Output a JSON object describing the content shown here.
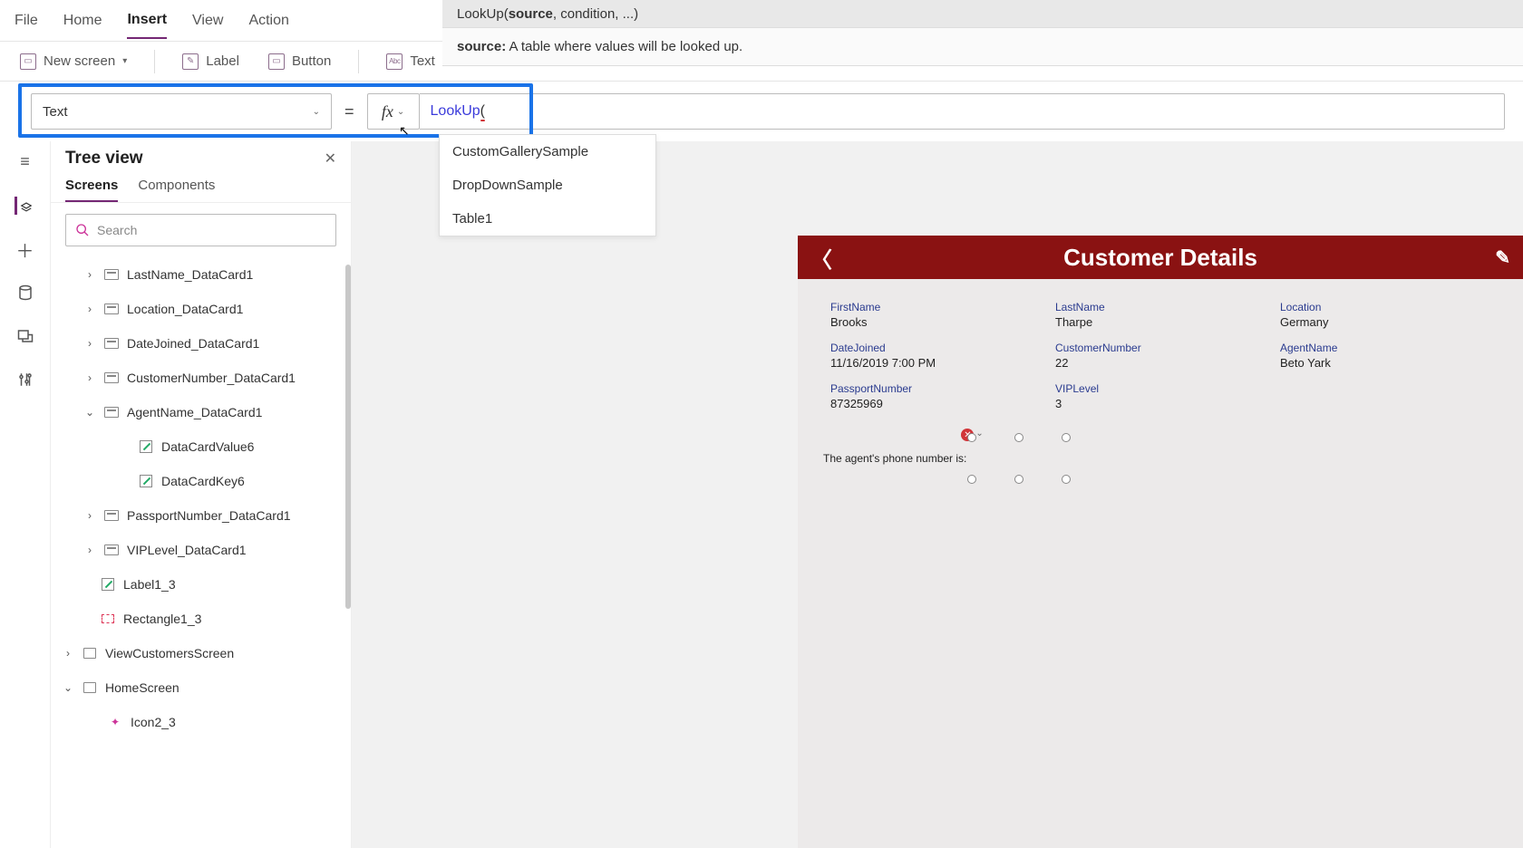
{
  "menubar": {
    "file": "File",
    "home": "Home",
    "insert": "Insert",
    "view": "View",
    "action": "Action"
  },
  "ribbon": {
    "new_screen": "New screen",
    "label": "Label",
    "button": "Button",
    "text": "Text"
  },
  "formula": {
    "property": "Text",
    "eq": "=",
    "fx": "fx",
    "fn_name": "LookUp",
    "fn_paren": "("
  },
  "hint": {
    "signature_pre": "LookUp(",
    "signature_bold": "source",
    "signature_post": ", condition, ...)",
    "desc_bold": "source:",
    "desc_text": " A table where values will be looked up."
  },
  "suggestions": [
    "CustomGallerySample",
    "DropDownSample",
    "Table1"
  ],
  "tree": {
    "title": "Tree view",
    "tabs": {
      "screens": "Screens",
      "components": "Components"
    },
    "search_placeholder": "Search",
    "items": [
      {
        "label": "LastName_DataCard1",
        "icon": "card",
        "exp": ">",
        "indent": "item"
      },
      {
        "label": "Location_DataCard1",
        "icon": "card",
        "exp": ">",
        "indent": "item"
      },
      {
        "label": "DateJoined_DataCard1",
        "icon": "card",
        "exp": ">",
        "indent": "item"
      },
      {
        "label": "CustomerNumber_DataCard1",
        "icon": "card",
        "exp": ">",
        "indent": "item"
      },
      {
        "label": "AgentName_DataCard1",
        "icon": "card",
        "exp": "v",
        "indent": "item"
      },
      {
        "label": "DataCardValue6",
        "icon": "edit",
        "exp": "",
        "indent": "child"
      },
      {
        "label": "DataCardKey6",
        "icon": "edit",
        "exp": "",
        "indent": "child"
      },
      {
        "label": "PassportNumber_DataCard1",
        "icon": "card",
        "exp": ">",
        "indent": "item"
      },
      {
        "label": "VIPLevel_DataCard1",
        "icon": "card",
        "exp": ">",
        "indent": "item"
      },
      {
        "label": "Label1_3",
        "icon": "edit",
        "exp": "",
        "indent": "sibling"
      },
      {
        "label": "Rectangle1_3",
        "icon": "rect",
        "exp": "",
        "indent": "sibling"
      },
      {
        "label": "ViewCustomersScreen",
        "icon": "screen",
        "exp": ">",
        "indent": "root"
      },
      {
        "label": "HomeScreen",
        "icon": "screen",
        "exp": "v",
        "indent": "root"
      },
      {
        "label": "Icon2_3",
        "icon": "icon2",
        "exp": "",
        "indent": "rootchild"
      }
    ]
  },
  "canvas": {
    "header": "Customer Details",
    "fields": {
      "firstName": {
        "label": "FirstName",
        "value": "Brooks"
      },
      "lastName": {
        "label": "LastName",
        "value": "Tharpe"
      },
      "location": {
        "label": "Location",
        "value": "Germany"
      },
      "dateJoined": {
        "label": "DateJoined",
        "value": "11/16/2019 7:00 PM"
      },
      "customerNumber": {
        "label": "CustomerNumber",
        "value": "22"
      },
      "agentName": {
        "label": "AgentName",
        "value": "Beto Yark"
      },
      "passportNumber": {
        "label": "PassportNumber",
        "value": "87325969"
      },
      "vipLevel": {
        "label": "VIPLevel",
        "value": "3"
      }
    },
    "agentPhoneLabel": "The agent's phone number is:"
  }
}
